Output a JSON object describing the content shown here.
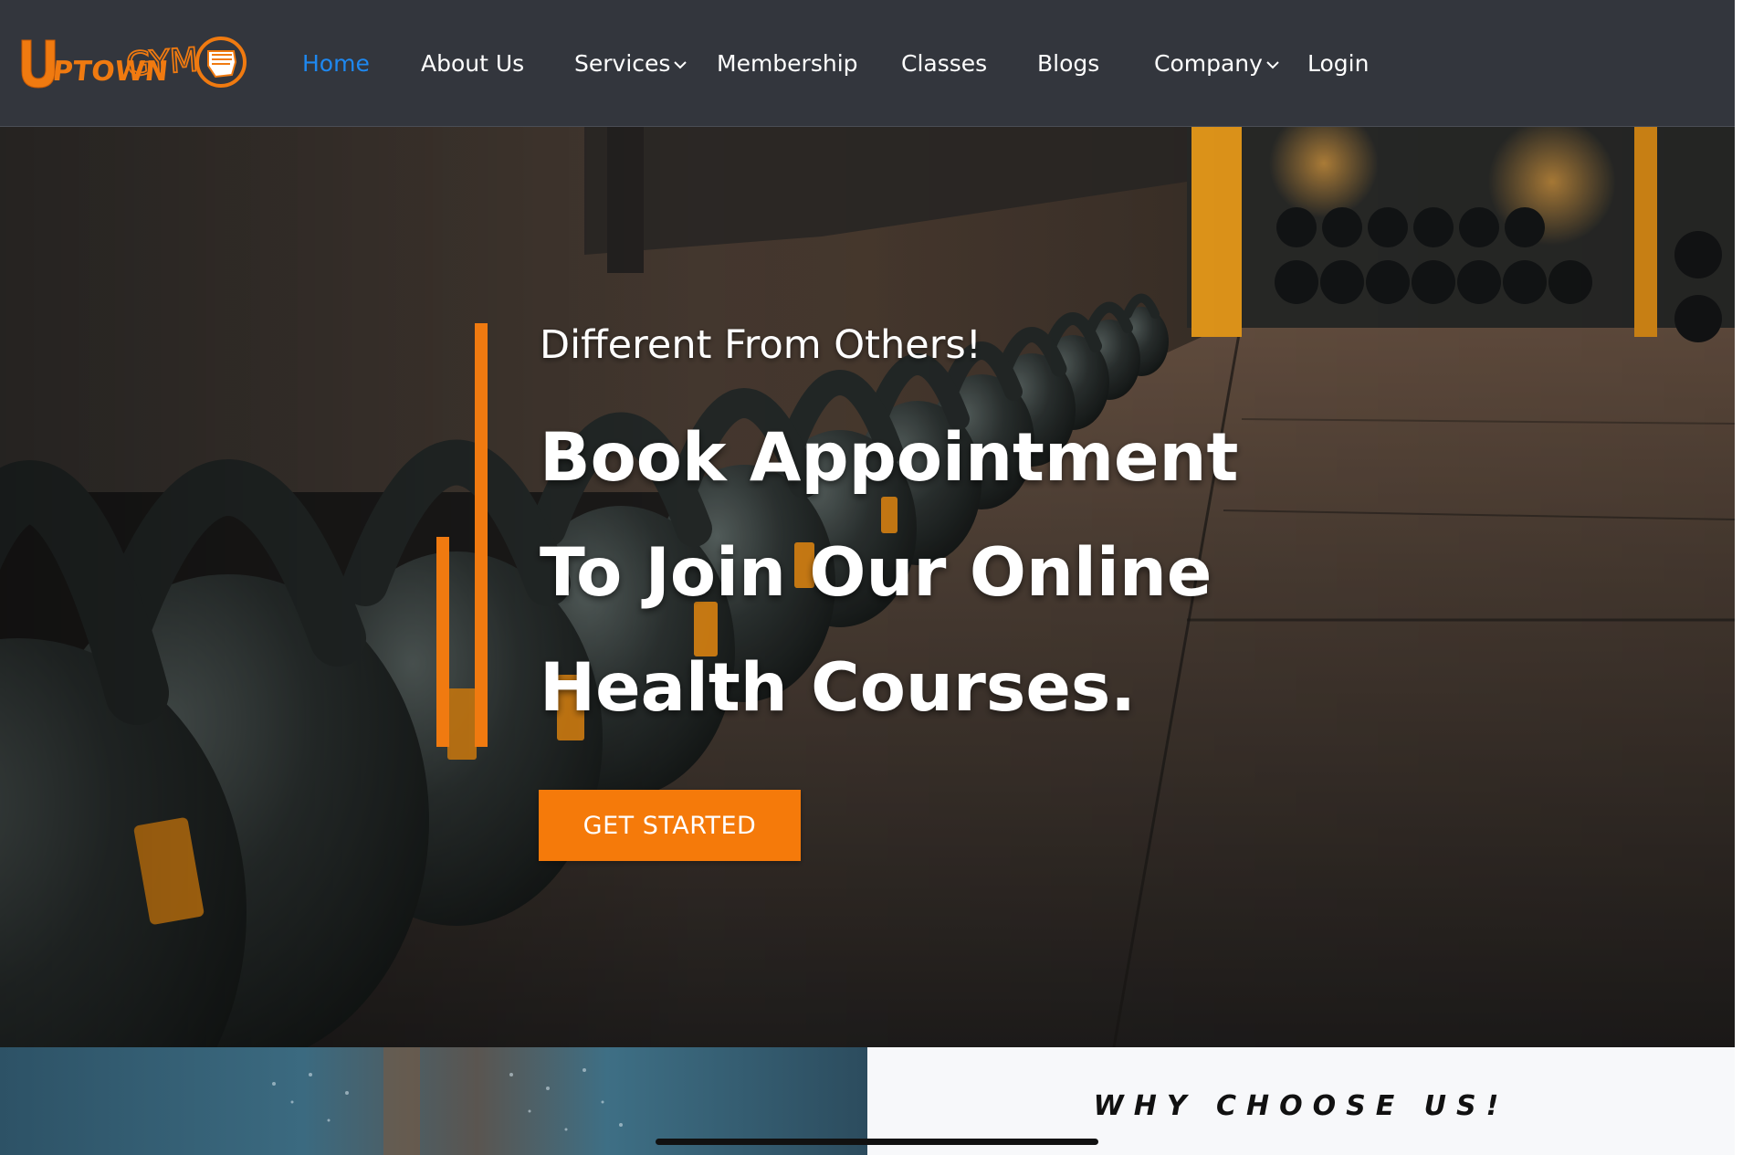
{
  "brand": {
    "logo_text": "UptownGym",
    "colors": {
      "primary": "#f57a0a",
      "nav_bg": "#33363d",
      "active_link": "#1e88f0"
    }
  },
  "nav": {
    "items": [
      {
        "label": "Home",
        "active": true
      },
      {
        "label": "About Us"
      },
      {
        "label": "Services",
        "has_dropdown": true
      },
      {
        "label": "Membership"
      },
      {
        "label": "Classes"
      },
      {
        "label": "Blogs"
      },
      {
        "label": "Company",
        "has_dropdown": true
      },
      {
        "label": "Login"
      }
    ],
    "caret_icon": "chevron-down-icon"
  },
  "hero": {
    "eyebrow": "Different From Others!",
    "heading_lines": [
      "Book Appointment",
      "To Join Our Online",
      "Health Courses."
    ],
    "cta_label": "GET STARTED",
    "background": "kettlebells-photo"
  },
  "section": {
    "why_title": "WHY CHOOSE US!"
  }
}
